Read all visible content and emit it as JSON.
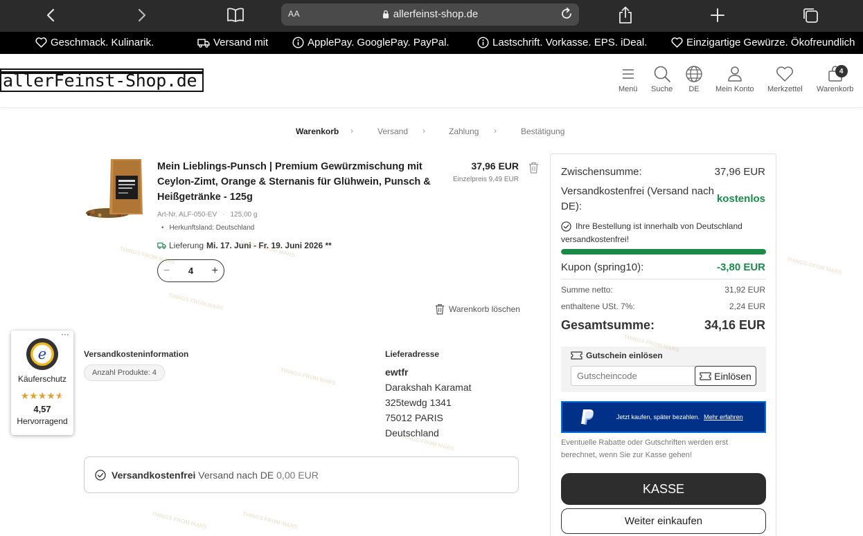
{
  "browser": {
    "reader_label": "AA",
    "url": "allerfeinst-shop.de"
  },
  "promo": {
    "items": [
      "Geschmack. Kulinarik.",
      "Versand mit",
      "ApplePay. GooglePay. PayPal.",
      "Lastschrift. Vorkasse. EPS. iDeal.",
      "Einzigartige Gewürze. Ökofreundlich"
    ]
  },
  "header": {
    "logo": "allerFeinst-Shop.de",
    "nav": {
      "menu": "Menü",
      "search": "Suche",
      "language": "DE",
      "account": "Mein Konto",
      "wishlist": "Merkzettel",
      "cart": "Warenkorb",
      "cart_count": "4"
    }
  },
  "steps": [
    "Warenkorb",
    "Versand",
    "Zahlung",
    "Bestätigung"
  ],
  "product": {
    "title": "Mein Lieblings-Punsch | Premium Gewürzmischung mit Ceylon-Zimt, Orange & Sternanis für Glühwein, Punsch & Heißgetränke - 125g",
    "price": "37,96 EUR",
    "unit_price": "Einzelpreis 9,49 EUR",
    "article_no": "Art-Nr. ALF-050-EV",
    "weight": "125,00 g",
    "origin": "Herkunftsland: Deutschland",
    "delivery_label": "Lieferung",
    "delivery_dates": "Mi. 17. Juni - Fr. 19. Juni 2026 **",
    "quantity": "4",
    "clear_cart": "Warenkorb löschen"
  },
  "shipping_info": {
    "title": "Versandkosteninformation",
    "products_count": "Anzahl Produkte: 4"
  },
  "address": {
    "title": "Lieferadresse",
    "name": "ewtfr",
    "line1": "Darakshah Karamat",
    "line2": "325tewdg 1341",
    "line3": "75012 PARIS",
    "country": "Deutschland"
  },
  "shipbox": {
    "bold": "Versandkostenfrei",
    "text": "Versand nach DE",
    "amount": "0,00 EUR"
  },
  "trusted": {
    "label": "Käuferschutz",
    "score": "4,57",
    "rating": 4.57,
    "word": "Hervorragend"
  },
  "summary": {
    "subtotal_label": "Zwischensumme:",
    "subtotal": "37,96 EUR",
    "shipping_label": "Versandkostenfrei (Versand nach DE):",
    "shipping_value": "kostenlos",
    "free_note": "Ihre Bestellung ist innerhalb von Deutschland versandkostenfrei!",
    "free_progress": 1.0,
    "coupon_label": "Kupon (spring10):",
    "coupon_value": "-3,80 EUR",
    "net_label": "Summe netto:",
    "net_value": "31,92 EUR",
    "vat_label": "enthaltene USt. 7%:",
    "vat_value": "2,24 EUR",
    "total_label": "Gesamtsumme:",
    "total_value": "34,16 EUR",
    "voucher_title": "Gutschein einlösen",
    "voucher_placeholder": "Gutscheincode",
    "voucher_button": "Einlösen",
    "paypal_text": "Jetzt kaufen, später bezahlen.",
    "paypal_link": "Mehr erfahren",
    "note": "Eventuelle Rabatte oder Gutschriften werden erst berechnet, wenn Sie zur Kasse gehen!",
    "checkout": "KASSE",
    "continue": "Weiter einkaufen"
  },
  "watermark": "THINGS FROM MARS",
  "colors": {
    "accent_green": "#1b8a49",
    "dark": "#2d2d2d",
    "paypal_blue": "#003087",
    "star": "#e0a235"
  }
}
